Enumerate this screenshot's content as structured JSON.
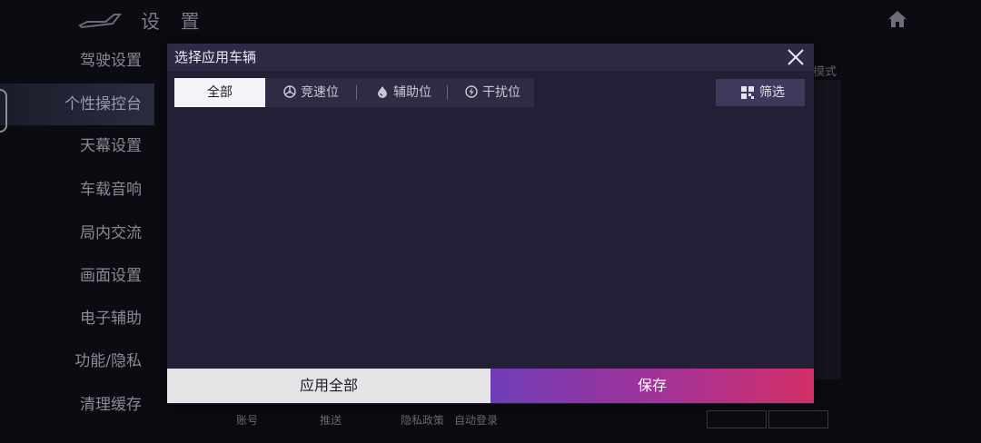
{
  "background": {
    "page_title": "设 置",
    "sidebar_items": [
      "驾驶设置",
      "个性操控台",
      "天幕设置",
      "车载音响",
      "局内交流",
      "画面设置",
      "电子辅助",
      "功能/隐私",
      "清理缓存"
    ],
    "active_item_index": 1,
    "right_hint": "模式",
    "bottom_labels": [
      "账号",
      "推送",
      "隐私政策",
      "自动登录"
    ]
  },
  "modal": {
    "title": "选择应用车辆",
    "tabs": [
      {
        "label": "全部",
        "icon": null,
        "active": true
      },
      {
        "label": "竞速位",
        "icon": "wheel-icon",
        "active": false
      },
      {
        "label": "辅助位",
        "icon": "drop-icon",
        "active": false
      },
      {
        "label": "干扰位",
        "icon": "bolt-icon",
        "active": false
      }
    ],
    "filter_label": "筛选",
    "filter_icon": "grid-filter-icon",
    "apply_all_label": "应用全部",
    "save_label": "保存"
  },
  "colors": {
    "modal_bg": "#231f37",
    "save_gradient": [
      "#6f3db8",
      "#a53296",
      "#d42f68"
    ]
  }
}
